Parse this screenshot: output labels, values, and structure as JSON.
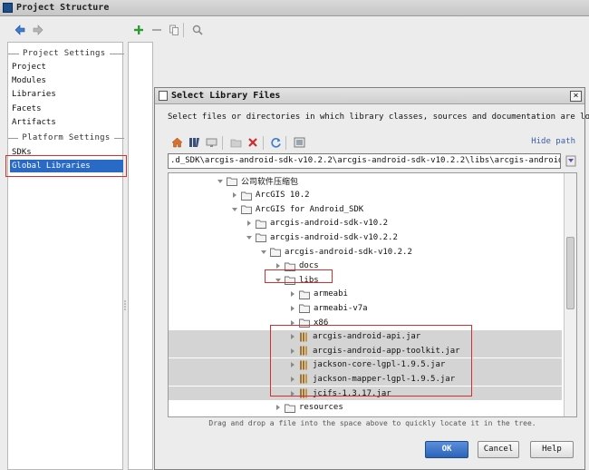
{
  "main_window": {
    "title": "Project Structure",
    "toolbar": {
      "back_icon": "arrow-left-icon",
      "forward_icon": "arrow-right-icon",
      "add_icon": "plus-icon",
      "remove_icon": "minus-icon",
      "copy_icon": "copy-icon",
      "find_icon": "magnifier-icon"
    },
    "sidebar": {
      "project_settings_title": "Project Settings",
      "platform_settings_title": "Platform Settings",
      "items": [
        {
          "label": "Project"
        },
        {
          "label": "Modules"
        },
        {
          "label": "Libraries"
        },
        {
          "label": "Facets"
        },
        {
          "label": "Artifacts"
        },
        {
          "label": "SDKs"
        },
        {
          "label": "Global Libraries",
          "selected": true
        }
      ]
    }
  },
  "dialog": {
    "title": "Select Library Files",
    "close_label": "×",
    "description": "Select files or directories in which library classes, sources and documentation are located",
    "hide_path_label": "Hide path",
    "path_value": ".d_SDK\\arcgis-android-sdk-v10.2.2\\arcgis-android-sdk-v10.2.2\\libs\\arcgis-android-api.jar",
    "toolbar_icons": [
      "home-icon",
      "project-icon",
      "desktop-icon",
      "new-folder-icon",
      "delete-icon",
      "refresh-icon",
      "show-hidden-icon"
    ],
    "tree": [
      {
        "label": "公司软件压缩包",
        "depth": 0,
        "type": "folder",
        "expanded": true
      },
      {
        "label": "ArcGIS 10.2",
        "depth": 1,
        "type": "folder",
        "expanded": false
      },
      {
        "label": "ArcGIS for Android_SDK",
        "depth": 1,
        "type": "folder",
        "expanded": true
      },
      {
        "label": "arcgis-android-sdk-v10.2",
        "depth": 2,
        "type": "folder",
        "expanded": false
      },
      {
        "label": "arcgis-android-sdk-v10.2.2",
        "depth": 2,
        "type": "folder",
        "expanded": true
      },
      {
        "label": "arcgis-android-sdk-v10.2.2",
        "depth": 3,
        "type": "folder",
        "expanded": true
      },
      {
        "label": "docs",
        "depth": 4,
        "type": "folder",
        "expanded": false
      },
      {
        "label": "libs",
        "depth": 4,
        "type": "folder",
        "expanded": true
      },
      {
        "label": "armeabi",
        "depth": 5,
        "type": "folder",
        "expanded": false
      },
      {
        "label": "armeabi-v7a",
        "depth": 5,
        "type": "folder",
        "expanded": false
      },
      {
        "label": "x86",
        "depth": 5,
        "type": "folder",
        "expanded": false
      },
      {
        "label": "arcgis-android-api.jar",
        "depth": 5,
        "type": "jar",
        "highlighted": true
      },
      {
        "label": "arcgis-android-app-toolkit.jar",
        "depth": 5,
        "type": "jar",
        "highlighted": true
      },
      {
        "label": "jackson-core-lgpl-1.9.5.jar",
        "depth": 5,
        "type": "jar",
        "highlighted": true
      },
      {
        "label": "jackson-mapper-lgpl-1.9.5.jar",
        "depth": 5,
        "type": "jar",
        "highlighted": true
      },
      {
        "label": "jcifs-1.3.17.jar",
        "depth": 5,
        "type": "jar",
        "highlighted": true
      },
      {
        "label": "resources",
        "depth": 4,
        "type": "folder",
        "expanded": false
      }
    ],
    "drag_hint": "Drag and drop a file into the space above to quickly locate it in the tree.",
    "buttons": {
      "ok": "OK",
      "cancel": "Cancel",
      "help": "Help"
    }
  },
  "colors": {
    "selection_blue": "#2a6ac7",
    "annotation_red": "#d03030",
    "row_highlight": "#d4d4d4"
  }
}
